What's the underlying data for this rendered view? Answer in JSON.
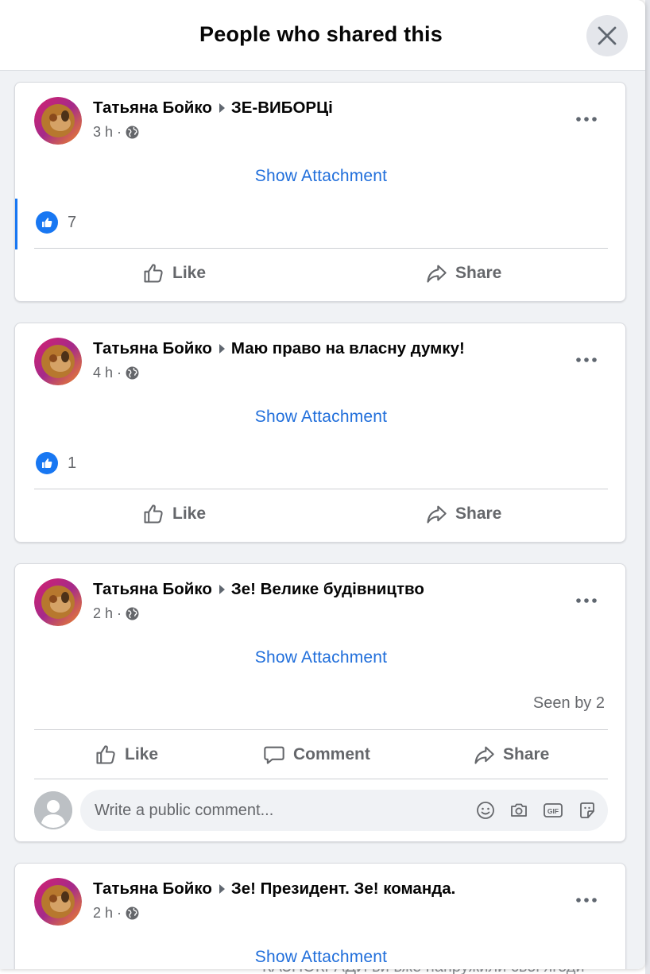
{
  "dialog": {
    "title": "People who shared this"
  },
  "background_text": "КАЗНОКРАДИ ви вже напружили своі ягоди",
  "posts": [
    {
      "author": "Татьяна Бойко",
      "group": "ЗЕ-ВИБОРЦі",
      "time": "3 h",
      "attachment_label": "Show Attachment",
      "likes": "7",
      "like_label": "Like",
      "share_label": "Share"
    },
    {
      "author": "Татьяна Бойко",
      "group": "Маю право на власну думку!",
      "time": "4 h",
      "attachment_label": "Show Attachment",
      "likes": "1",
      "like_label": "Like",
      "share_label": "Share"
    },
    {
      "author": "Татьяна Бойко",
      "group": "Зе! Велике будівництво",
      "time": "2 h",
      "attachment_label": "Show Attachment",
      "seen": "Seen by 2",
      "like_label": "Like",
      "comment_label": "Comment",
      "share_label": "Share",
      "comment_placeholder": "Write a public comment..."
    },
    {
      "author": "Татьяна Бойко",
      "group": "Зе! Президент. Зе! команда.",
      "time": "2 h",
      "attachment_label": "Show Attachment"
    }
  ],
  "meta_separator": "·",
  "icons": {
    "close": "close-icon",
    "more": "more-options-icon",
    "privacy": "globe-icon",
    "like": "thumbs-up-icon",
    "share": "share-arrow-icon",
    "comment": "comment-bubble-icon"
  },
  "colors": {
    "accent": "#1877f2",
    "link": "#216fdb",
    "secondary_text": "#65676b",
    "page_bg": "#f0f2f5"
  }
}
